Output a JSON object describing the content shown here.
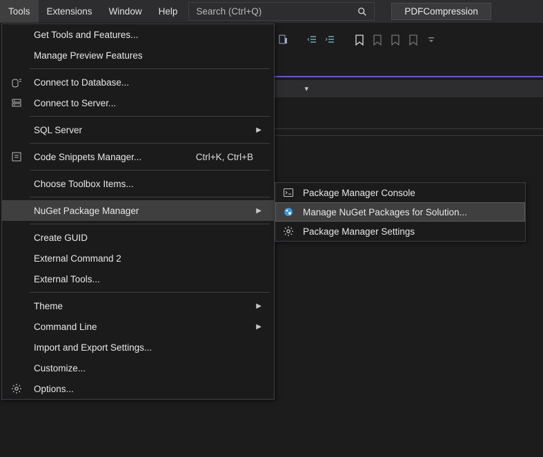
{
  "menubar": {
    "tools": "Tools",
    "extensions": "Extensions",
    "window": "Window",
    "help": "Help"
  },
  "search": {
    "placeholder": "Search (Ctrl+Q)"
  },
  "solution_name": "PDFCompression",
  "tools_menu": {
    "get_tools": "Get Tools and Features...",
    "manage_preview": "Manage Preview Features",
    "connect_db": "Connect to Database...",
    "connect_server": "Connect to Server...",
    "sql_server": "SQL Server",
    "code_snippets": "Code Snippets Manager...",
    "code_snippets_shortcut": "Ctrl+K, Ctrl+B",
    "choose_toolbox": "Choose Toolbox Items...",
    "nuget": "NuGet Package Manager",
    "create_guid": "Create GUID",
    "ext_cmd2": "External Command 2",
    "ext_tools": "External Tools...",
    "theme": "Theme",
    "command_line": "Command Line",
    "import_export": "Import and Export Settings...",
    "customize": "Customize...",
    "options": "Options..."
  },
  "nuget_submenu": {
    "console": "Package Manager Console",
    "manage": "Manage NuGet Packages for Solution...",
    "settings": "Package Manager Settings"
  }
}
